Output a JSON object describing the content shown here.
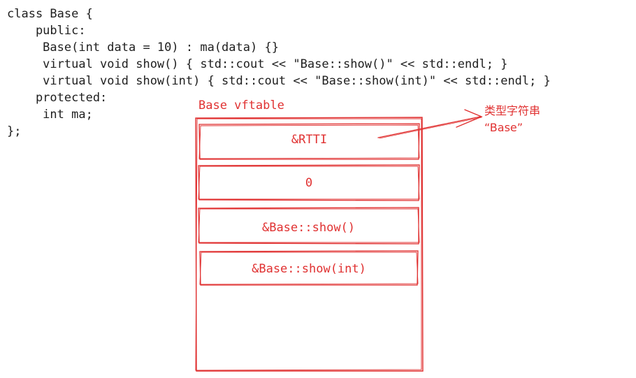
{
  "code": {
    "lines": [
      "class Base {",
      "    public:",
      "     Base(int data = 10) : ma(data) {}",
      "     virtual void show() { std::cout << \"Base::show()\" << std::endl; }",
      "     virtual void show(int) { std::cout << \"Base::show(int)\" << std::endl; }",
      "    protected:",
      "     int ma;",
      "};"
    ]
  },
  "vftable": {
    "title": "Base vftable",
    "slots": [
      "&RTTI",
      "0",
      "&Base::show()",
      "&Base::show(int)"
    ]
  },
  "annotation": {
    "line1": "类型字符串",
    "line2": "“Base”"
  },
  "colors": {
    "accent": "#e03131",
    "text": "#1e1e1e"
  }
}
